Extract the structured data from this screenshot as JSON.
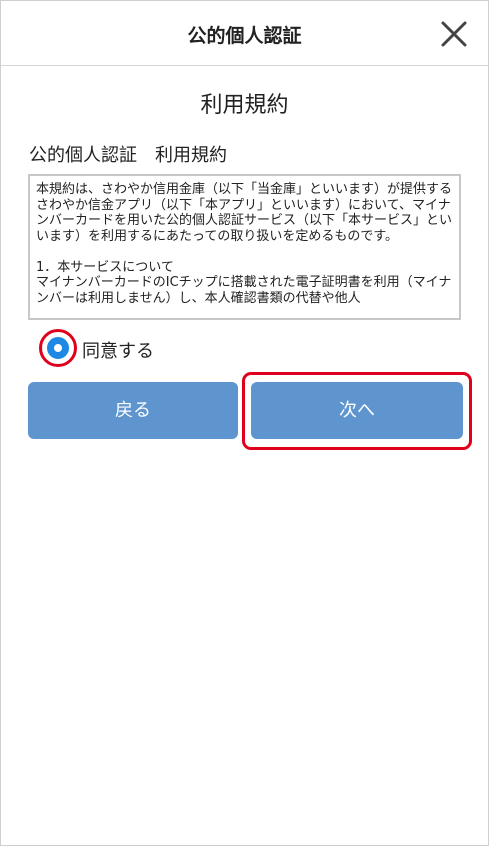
{
  "header": {
    "title": "公的個人認証",
    "close_icon": "close-icon"
  },
  "page": {
    "title": "利用規約",
    "section_title": "公的個人認証　利用規約"
  },
  "terms": {
    "text": "本規約は、さわやか信用金庫（以下「当金庫」といいます）が提供するさわやか信金アプリ（以下「本アプリ」といいます）において、マイナンバーカードを用いた公的個人認証サービス（以下「本サービス」といいます）を利用するにあたっての取り扱いを定めるものです。\n\n1．本サービスについて\nマイナンバーカードのICチップに搭載された電子証明書を利用（マイナンバーは利用しません）し、本人確認書類の代替や他人"
  },
  "agree": {
    "label": "同意する",
    "checked": true,
    "radio_color": "#1e88e5",
    "highlight_color": "#e0001b"
  },
  "buttons": {
    "back_label": "戻る",
    "next_label": "次へ",
    "color": "#5f95cf"
  }
}
